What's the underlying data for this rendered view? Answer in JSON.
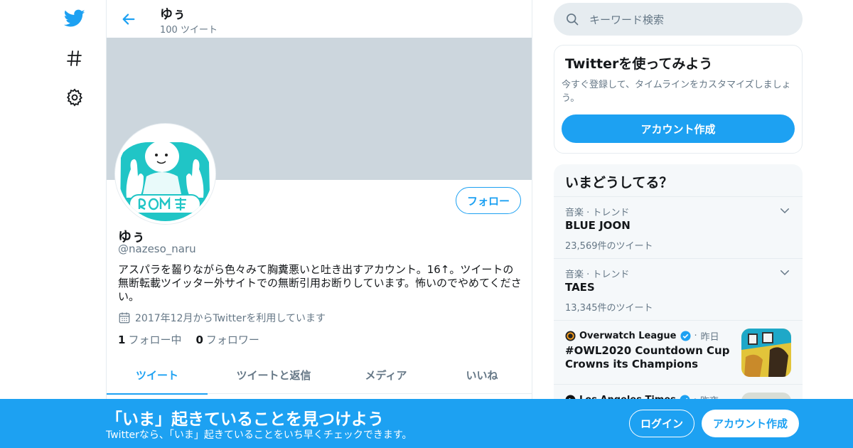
{
  "colors": {
    "accent": "#1da1f2",
    "banner": "#ccd6dd",
    "avatar_teal": "#20c5c6",
    "muted": "#657786"
  },
  "nav": {
    "icons": [
      "twitter-bird-icon",
      "hashtag-icon",
      "gear-icon"
    ]
  },
  "header": {
    "name": "ゆぅ",
    "tweet_count": "100 ツイート"
  },
  "profile": {
    "follow_label": "フォロー",
    "name": "ゆぅ",
    "handle": "@nazeso_naru",
    "bio": "アスパラを齧りながら色々みて胸糞悪いと吐き出すアカウント。16↑。ツイートの無断転載ツイッター外サイトでの無断引用お断りしています。怖いのでやめてください。",
    "joined": "2017年12月からTwitterを利用しています",
    "following_count": "1",
    "following_label": "フォロー中",
    "followers_count": "0",
    "followers_label": "フォロワー"
  },
  "tabs": [
    {
      "label": "ツイート",
      "active": true
    },
    {
      "label": "ツイートと返信",
      "active": false
    },
    {
      "label": "メディア",
      "active": false
    },
    {
      "label": "いいね",
      "active": false
    }
  ],
  "search": {
    "placeholder": "キーワード検索"
  },
  "signup_card": {
    "title": "Twitterを使ってみよう",
    "desc": "今すぐ登録して、タイムラインをカスタマイズしましょう。",
    "button": "アカウント作成"
  },
  "trends": {
    "title": "いまどうしてる？",
    "items": [
      {
        "meta": "音楽 · トレンド",
        "name": "BLUE JOON",
        "count": "23,569件のツイート"
      },
      {
        "meta": "音楽 · トレンド",
        "name": "TAES",
        "count": "13,345件のツイート"
      }
    ],
    "news": [
      {
        "source": "Overwatch League",
        "time": "昨日",
        "title": "#OWL2020 Countdown Cup Crowns its Champions"
      },
      {
        "source": "Los Angeles Times",
        "time": "昨夜"
      }
    ]
  },
  "bottom_bar": {
    "title": "「いま」起きていることを見つけよう",
    "subtitle": "Twitterなら、「いま」起きていることをいち早くチェックできます。",
    "login": "ログイン",
    "signup": "アカウント作成"
  }
}
